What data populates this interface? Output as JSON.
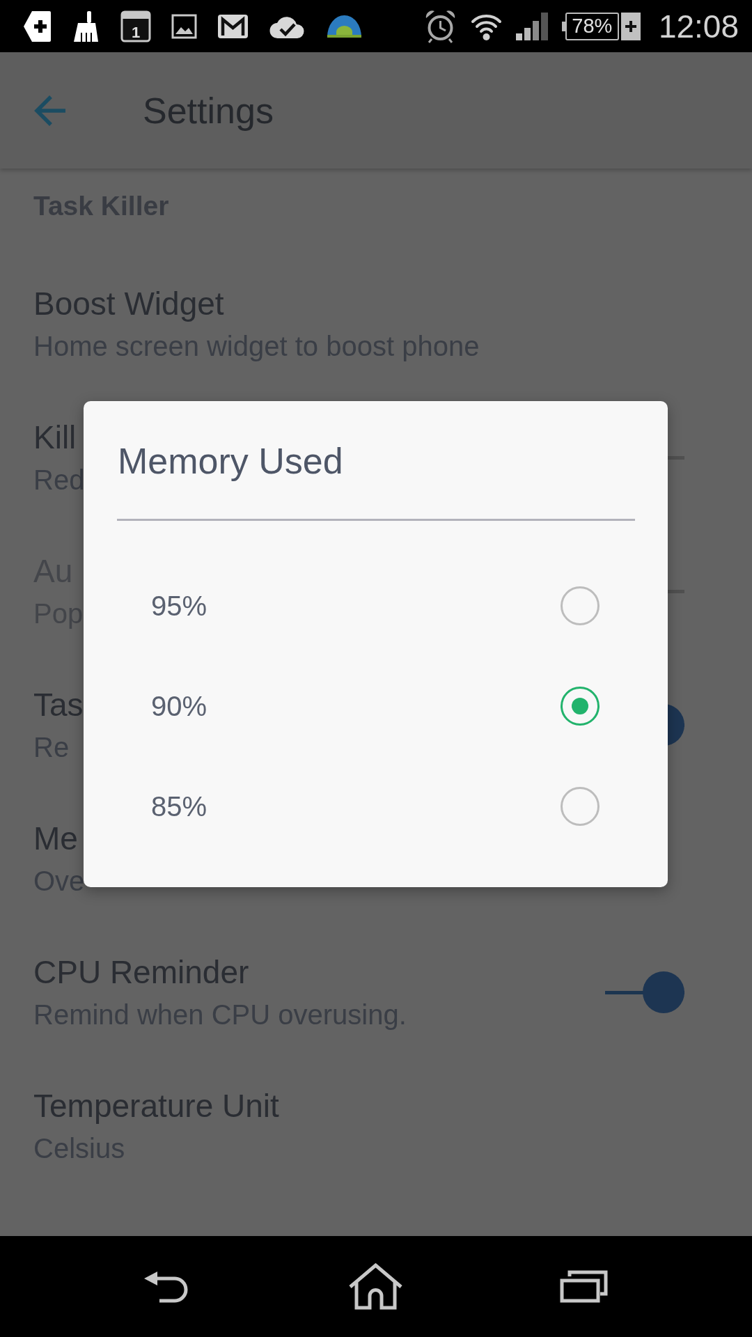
{
  "status_bar": {
    "calendar_day": "1",
    "battery_text": "78%",
    "time": "12:08"
  },
  "app_bar": {
    "title": "Settings"
  },
  "section": {
    "title": "Task Killer"
  },
  "rows": [
    {
      "title": "Boost Widget",
      "subtitle": "Home screen widget to boost phone",
      "kind": "plain",
      "disabled": false
    },
    {
      "title": "Kill",
      "subtitle": "Red",
      "kind": "switch",
      "on": false,
      "disabled": false
    },
    {
      "title": "Au",
      "subtitle": "Pop",
      "kind": "switch",
      "on": false,
      "disabled": true
    },
    {
      "title": "Tas",
      "subtitle": "Re",
      "kind": "switch",
      "on": true,
      "disabled": false
    },
    {
      "title": "Me",
      "subtitle": "Ove",
      "kind": "plain",
      "disabled": false
    },
    {
      "title": "CPU Reminder",
      "subtitle": "Remind when CPU overusing.",
      "kind": "switch",
      "on": true,
      "disabled": false
    },
    {
      "title": "Temperature Unit",
      "subtitle": "Celsius",
      "kind": "plain",
      "disabled": false
    }
  ],
  "dialog": {
    "title": "Memory Used",
    "options": [
      {
        "label": "95%",
        "selected": false
      },
      {
        "label": "90%",
        "selected": true
      },
      {
        "label": "85%",
        "selected": false
      }
    ]
  }
}
